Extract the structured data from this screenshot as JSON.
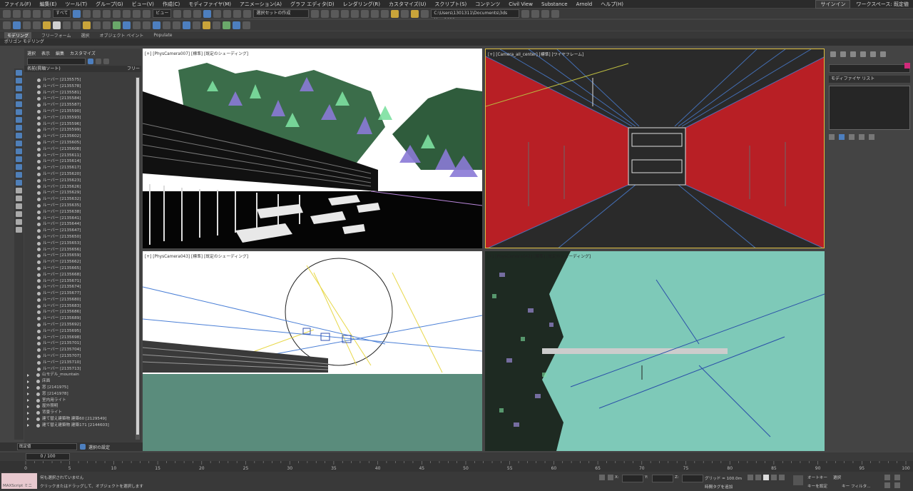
{
  "menubar": {
    "items": [
      "ファイル(F)",
      "編集(E)",
      "ツール(T)",
      "グループ(G)",
      "ビュー(V)",
      "作成(C)",
      "モディファイヤ(M)",
      "アニメーション(A)",
      "グラフ エディタ(D)",
      "レンダリング(R)",
      "カスタマイズ(U)",
      "スクリプト(S)",
      "コンテンツ",
      "Civil View",
      "Substance",
      "Arnold",
      "ヘルプ(H)"
    ],
    "signin": "サインイン",
    "workspace": "ワークスペース: 既定値"
  },
  "toolbar": {
    "filter_select": "すべて",
    "view_select": "ビュー",
    "selset_select": "選択セットの作成",
    "project_path": "C:\\Users\\1301311\\Documents\\3ds Max 2022"
  },
  "ribbon": {
    "tabs": [
      "モデリング",
      "フリーフォーム",
      "選択",
      "オブジェクト ペイント",
      "Populate"
    ],
    "subtitle": "ポリゴン モデリング"
  },
  "explorer": {
    "tabs": [
      "選択",
      "表示",
      "編集",
      "カスタマイズ"
    ],
    "column_header": "名前(昇順ソート)",
    "column_right": "フリー",
    "items": [
      "ルーバー [2135575]",
      "ルーバー [2135578]",
      "ルーバー [2135581]",
      "ルーバー [2135584]",
      "ルーバー [2135587]",
      "ルーバー [2135590]",
      "ルーバー [2135593]",
      "ルーバー [2135596]",
      "ルーバー [2135599]",
      "ルーバー [2135602]",
      "ルーバー [2135605]",
      "ルーバー [2135608]",
      "ルーバー [2135611]",
      "ルーバー [2135614]",
      "ルーバー [2135617]",
      "ルーバー [2135620]",
      "ルーバー [2135623]",
      "ルーバー [2135626]",
      "ルーバー [2135629]",
      "ルーバー [2135632]",
      "ルーバー [2135635]",
      "ルーバー [2135638]",
      "ルーバー [2135641]",
      "ルーバー [2135644]",
      "ルーバー [2135647]",
      "ルーバー [2135650]",
      "ルーバー [2135653]",
      "ルーバー [2135656]",
      "ルーバー [2135659]",
      "ルーバー [2135662]",
      "ルーバー [2135665]",
      "ルーバー [2135668]",
      "ルーバー [2135671]",
      "ルーバー [2135674]",
      "ルーバー [2135677]",
      "ルーバー [2135680]",
      "ルーバー [2135683]",
      "ルーバー [2135686]",
      "ルーバー [2135689]",
      "ルーバー [2135692]",
      "ルーバー [2135695]",
      "ルーバー [2135698]",
      "ルーバー [2135701]",
      "ルーバー [2135704]",
      "ルーバー [2135707]",
      "ルーバー [2135710]",
      "ルーバー [2135713]"
    ],
    "groups": [
      "山モデル_mountain",
      "床面",
      "窓 [2141975]",
      "窓 [2141978]",
      "室内用ライト",
      "屋外照明",
      "背景ライト",
      "建て替え建築物 建築60 [2129549]",
      "建て替え建築物 建築171 [2144603]"
    ],
    "footer_combo": "既定値",
    "footer_label": "選択の設定"
  },
  "viewports": {
    "top_left": "[+] [PhysCamera007] [標準] [既定のシェーディング]",
    "top_right": "[+] [Camera_all_center] [標準] [ワイヤフレーム]",
    "bottom_left": "[+] [PhysCamera043] [標準] [既定のシェーディング]",
    "bottom_right": "[+] [PhysCamera042] [標準] [既定のシェーディング]"
  },
  "command_panel": {
    "modifier_list": "モディファイヤ リスト"
  },
  "timeline": {
    "frame": "0 / 100",
    "ticks": [
      "0",
      "5",
      "10",
      "15",
      "20",
      "25",
      "30",
      "35",
      "40",
      "45",
      "50",
      "55",
      "60",
      "65",
      "70",
      "75",
      "80",
      "85",
      "90",
      "95",
      "100"
    ]
  },
  "status": {
    "maxscript": "MAXScript ミニ",
    "line1": "何も選択されていません",
    "line2": "クリックまたはドラッグして、オブジェクトを選択します",
    "x_label": "X:",
    "y_label": "Y:",
    "z_label": "Z:",
    "grid": "グリッド = 100.0m",
    "time_tag": "時間タグを追加",
    "auto_key": "オートキー",
    "set_key": "キーを設定",
    "selected": "選択",
    "key_filter": "キー フィルタ..."
  },
  "colors": {
    "red_wall": "#b81f25",
    "wire_blue": "#4a7fd6",
    "ground_teal": "#5a8c7c",
    "cyan_bg": "#7ec9b8",
    "active_border": "#e0c040"
  }
}
